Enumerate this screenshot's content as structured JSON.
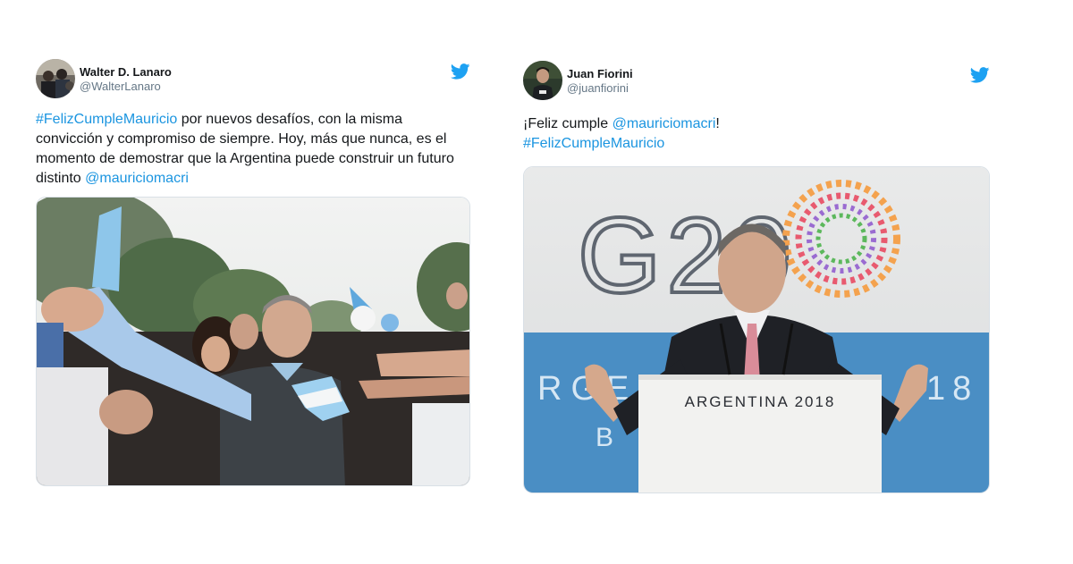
{
  "tweets": [
    {
      "author_name": "Walter D. Lanaro",
      "handle": "@WalterLanaro",
      "text": {
        "hashtag": "#FelizCumpleMauricio",
        "body": " por nuevos desafíos, con la misma convicción y compromiso de siempre. Hoy, más que nunca, es el momento de demostrar que la Argentina puede construir un futuro distinto ",
        "mention": "@mauriciomacri"
      },
      "icon": "twitter-bird-icon"
    },
    {
      "author_name": "Juan Fiorini",
      "handle": "@juanfiorini",
      "text": {
        "prefix": "¡Feliz cumple ",
        "mention": "@mauriciomacri",
        "suffix": "!",
        "hashtag": "#FelizCumpleMauricio"
      },
      "media_text": {
        "logo": "G20",
        "backdrop_left": "RGEN",
        "backdrop_right": "18",
        "backdrop_b": "B",
        "podium": "ARGENTINA 2018"
      },
      "icon": "twitter-bird-icon"
    }
  ],
  "colors": {
    "link": "#1b95e0",
    "twitter_blue": "#1da1f2",
    "handle_gray": "#657786"
  }
}
